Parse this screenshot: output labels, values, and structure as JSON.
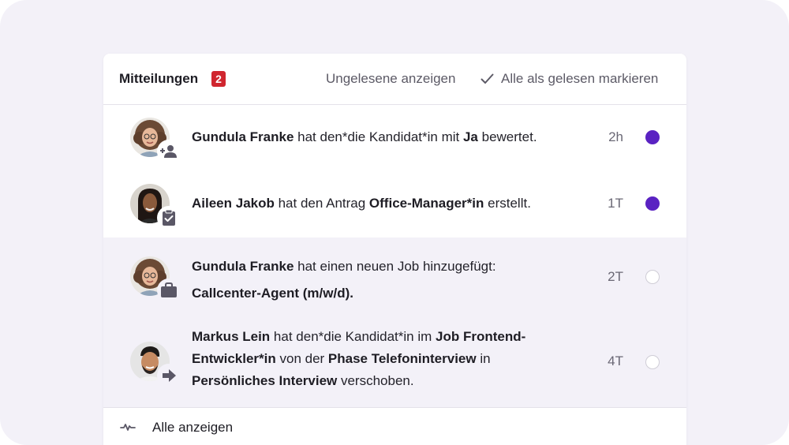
{
  "header": {
    "title": "Mitteilungen",
    "unread_count": "2",
    "show_unread": "Ungelesene anzeigen",
    "mark_all_read": "Alle als gelesen markieren"
  },
  "notifications": [
    {
      "actor": "Gundula Franke",
      "text_1": " hat den*die Kandidat*in mit ",
      "bold_1": "Ja",
      "text_2": " bewertet.",
      "time": "2h",
      "icon": "person-add-icon",
      "read": false
    },
    {
      "actor": "Aileen Jakob",
      "text_1": " hat den Antrag ",
      "bold_1": "Office-Manager*in",
      "text_2": " erstellt.",
      "time": "1T",
      "icon": "clipboard-check-icon",
      "read": false
    },
    {
      "actor": "Gundula Franke",
      "text_1": " hat einen neuen Job hinzugefügt:",
      "bold_1": "Callcenter-Agent (m/w/d).",
      "time": "2T",
      "icon": "briefcase-icon",
      "read": true
    },
    {
      "actor": "Markus Lein",
      "text_1": " hat den*die Kandidat*in im ",
      "bold_1": "Job Frontend-Entwickler*in",
      "text_2": " von der ",
      "bold_2": "Phase Telefoninterview",
      "text_3": " in ",
      "bold_3": "Persönliches Interview",
      "text_4": " verschoben.",
      "time": "4T",
      "icon": "arrow-right-icon",
      "read": true
    }
  ],
  "footer": {
    "label": "Alle anzeigen",
    "icon": "activity-icon"
  },
  "colors": {
    "accent": "#5a22c2",
    "badge": "#d0262f",
    "read_row_bg": "#f3f1f8"
  }
}
